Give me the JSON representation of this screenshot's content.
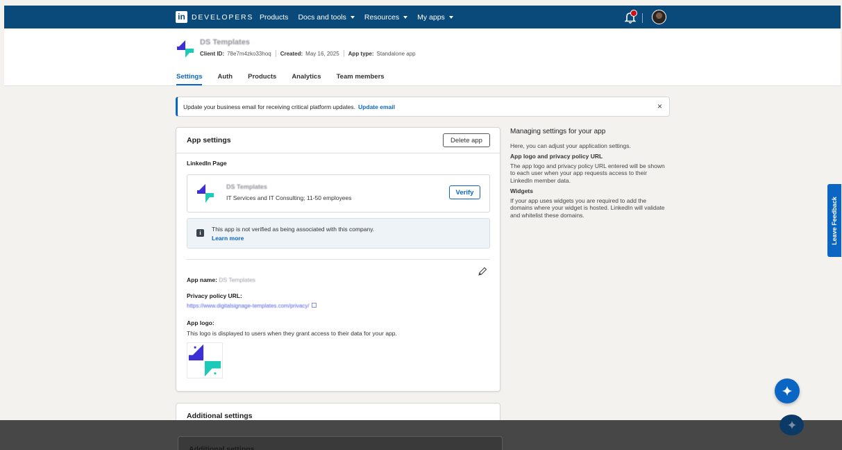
{
  "topbar": {
    "logo_text": "in",
    "brand": "DEVELOPERS",
    "nav": [
      {
        "label": "Products",
        "dropdown": false
      },
      {
        "label": "Docs and tools",
        "dropdown": true
      },
      {
        "label": "Resources",
        "dropdown": true
      },
      {
        "label": "My apps",
        "dropdown": true
      }
    ]
  },
  "app_header": {
    "title": "DS Templates",
    "client_id_label": "Client ID:",
    "client_id": "78e7m4zko33hoq",
    "created_label": "Created:",
    "created": "May 16, 2025",
    "app_type_label": "App type:",
    "app_type": "Standalone app",
    "tabs": [
      {
        "label": "Settings",
        "active": true
      },
      {
        "label": "Auth",
        "active": false
      },
      {
        "label": "Products",
        "active": false
      },
      {
        "label": "Analytics",
        "active": false
      },
      {
        "label": "Team members",
        "active": false
      }
    ]
  },
  "alert": {
    "text": "Update your business email for receiving critical platform updates.",
    "link": "Update email",
    "close": "×"
  },
  "app_settings": {
    "title": "App settings",
    "delete_label": "Delete app",
    "linkedin_page_label": "LinkedIn Page",
    "page_name": "DS Templates",
    "page_desc": "IT Services and IT Consulting; 11-50 employees",
    "verify_label": "Verify",
    "info_icon": "i",
    "info_text": "This app is not verified as being associated with this company.",
    "info_link": "Learn more",
    "app_name_label": "App name:",
    "app_name": "DS Templates",
    "privacy_label": "Privacy policy URL:",
    "privacy_url": "https://www.digitalsignage-templates.com/privacy/",
    "logo_label": "App logo:",
    "logo_desc": "This logo is displayed to users when they grant access to their data for your app."
  },
  "additional": {
    "title": "Additional settings"
  },
  "side_panel": {
    "title": "Managing settings for your app",
    "intro": "Here, you can adjust your application settings.",
    "h1": "App logo and privacy policy URL",
    "p1": "The app logo and privacy policy URL entered will be shown to each user when your app requests access to their LinkedIn member data.",
    "h2": "Widgets",
    "p2": "If your app uses widgets you are required to add the domains where your widget is hosted. LinkedIn will validate and whitelist these domains."
  },
  "feedback": {
    "label": "Leave Feedback"
  },
  "colors": {
    "brand_blue": "#0a66c2",
    "topbar": "#0a4a7a",
    "logo_violet": "#3d2fd6",
    "logo_teal": "#1dc9b7"
  }
}
